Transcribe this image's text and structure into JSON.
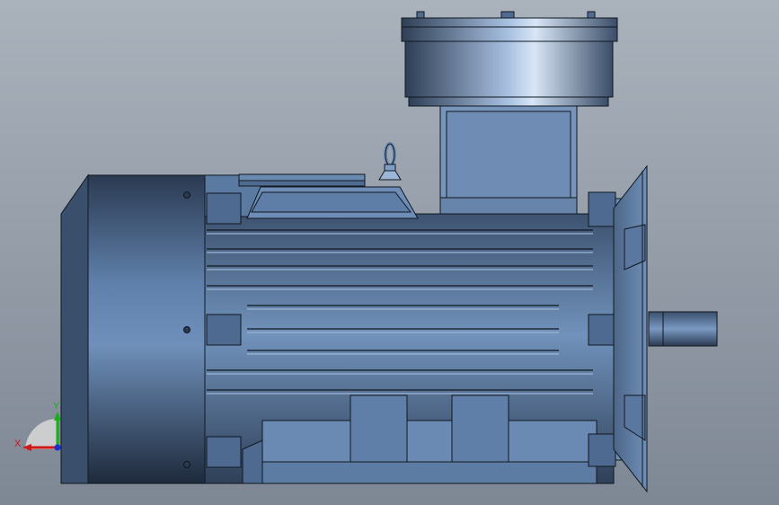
{
  "viewport": {
    "background_top": "#a9b1bb",
    "background_bottom": "#7f8895",
    "model_color": "#6d8cb3",
    "model_dark": "#2e3f57",
    "edge_color": "#101820"
  },
  "triad": {
    "x_label": "X",
    "y_label": "Y",
    "x_color": "#d01818",
    "y_color": "#18b018",
    "z_color": "#1830d0"
  }
}
